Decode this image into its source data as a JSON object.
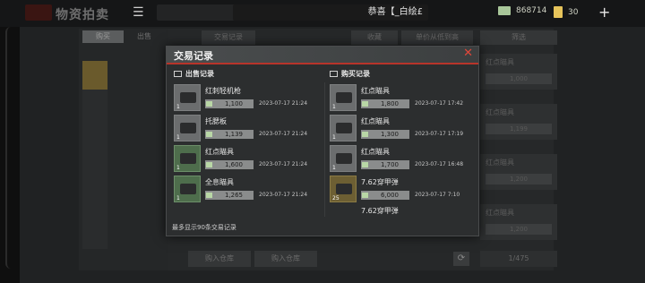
{
  "topbar": {
    "title": "物资拍卖",
    "marquee": "恭喜【_白绘£",
    "cash": "868714",
    "coupons": "30",
    "plus": "+"
  },
  "background": {
    "tab_buy": "购买",
    "tab_sell": "出售",
    "header_trade": "交易记录",
    "btn_collect": "收藏",
    "btn_sort": "单价从低到高",
    "btn_filter": "筛选",
    "btn_warehouse": "购入仓库",
    "btn_sell": "购入仓库",
    "page": "1/475",
    "right_items": [
      {
        "label": "红点瞄具",
        "price": "1,000"
      },
      {
        "label": "红点瞄具",
        "price": "1,199"
      },
      {
        "label": "红点瞄具",
        "price": "1,200"
      },
      {
        "label": "红点瞄具",
        "price": "1,200"
      }
    ]
  },
  "modal": {
    "title": "交易记录",
    "close": "✕",
    "sell_header": "出售记录",
    "buy_header": "购买记录",
    "footer": "最多显示90条交易记录",
    "sell_records": [
      {
        "name": "红刺轻机枪",
        "price": "1,100",
        "date": "2023-07-17 21:24",
        "count": "1"
      },
      {
        "name": "托腮板",
        "price": "1,139",
        "date": "2023-07-17 21:24",
        "count": "1"
      },
      {
        "name": "红点瞄具",
        "price": "1,600",
        "date": "2023-07-17 21:24",
        "count": "1"
      },
      {
        "name": "全息瞄具",
        "price": "1,265",
        "date": "2023-07-17 21:24",
        "count": "1"
      }
    ],
    "buy_records": [
      {
        "name": "红点瞄具",
        "price": "1,800",
        "date": "2023-07-17 17:42",
        "count": "1"
      },
      {
        "name": "红点瞄具",
        "price": "1,300",
        "date": "2023-07-17 17:19",
        "count": "1"
      },
      {
        "name": "红点瞄具",
        "price": "1,700",
        "date": "2023-07-17 16:48",
        "count": "1"
      },
      {
        "name": "7.62穿甲弹",
        "price": "6,000",
        "date": "2023-07-17 7:10",
        "count": "25"
      },
      {
        "name": "7.62穿甲弹",
        "price": "",
        "date": "",
        "count": ""
      }
    ]
  }
}
